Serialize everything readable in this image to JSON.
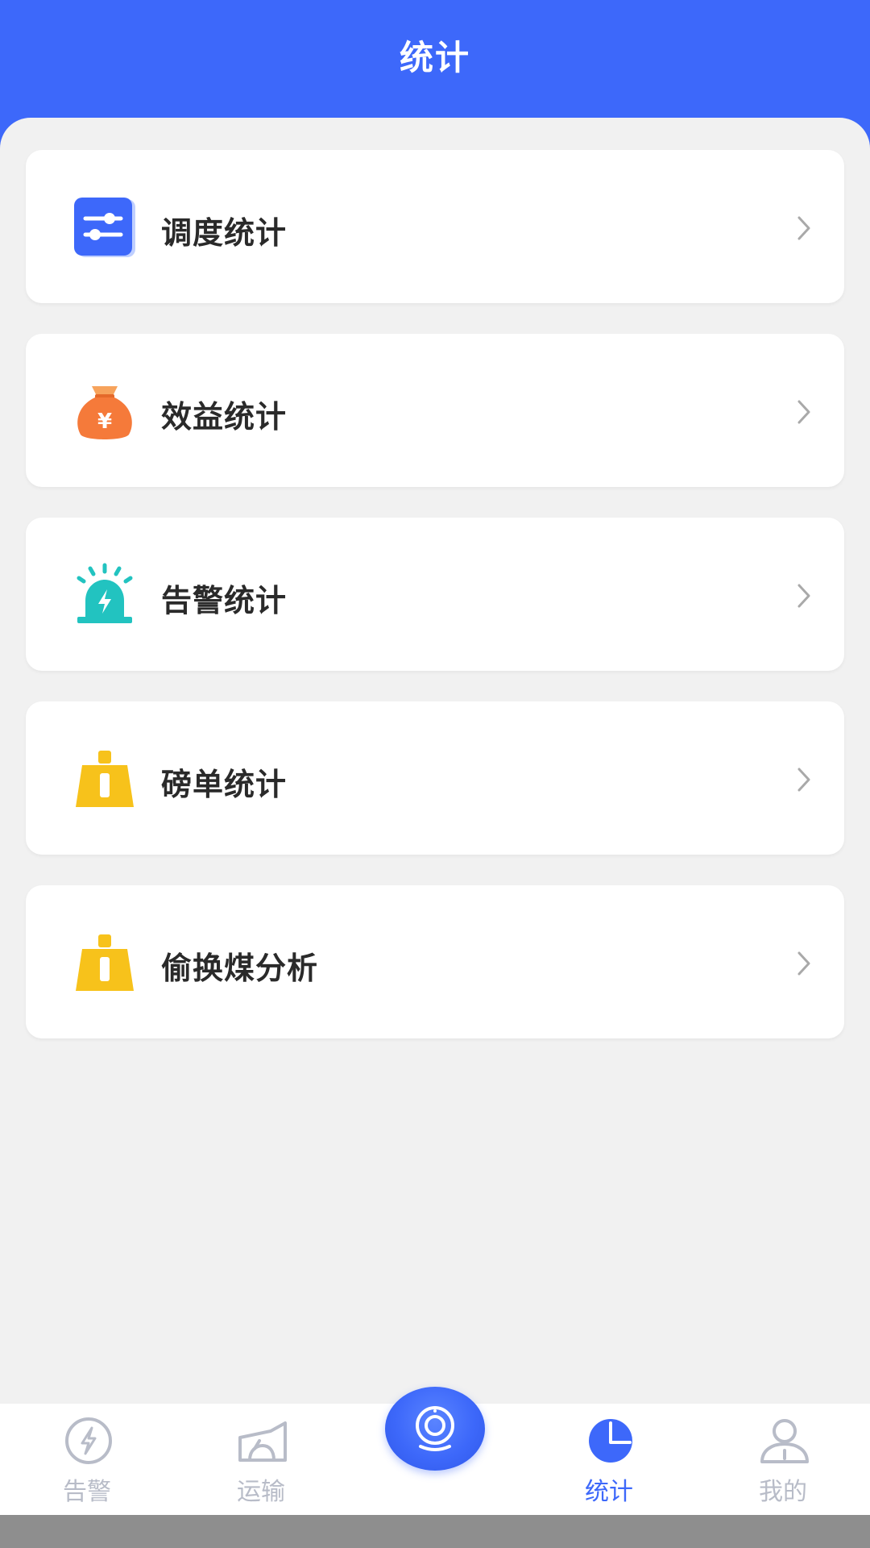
{
  "header": {
    "title": "统计"
  },
  "menu": {
    "items": [
      {
        "label": "调度统计",
        "icon": "sliders-icon"
      },
      {
        "label": "效益统计",
        "icon": "money-bag-icon"
      },
      {
        "label": "告警统计",
        "icon": "alarm-light-icon"
      },
      {
        "label": "磅单统计",
        "icon": "weight-icon"
      },
      {
        "label": "偷换煤分析",
        "icon": "weight-icon"
      }
    ]
  },
  "tabbar": {
    "items": [
      {
        "label": "告警",
        "icon": "lightning-circle-icon",
        "active": false
      },
      {
        "label": "运输",
        "icon": "transport-icon",
        "active": false
      },
      {
        "label": "",
        "icon": "camera-icon",
        "active": false
      },
      {
        "label": "统计",
        "icon": "pie-chart-icon",
        "active": true
      },
      {
        "label": "我的",
        "icon": "user-icon",
        "active": false
      }
    ]
  },
  "colors": {
    "primary": "#3d68fa",
    "background": "#f1f1f1",
    "card": "#ffffff",
    "tab_inactive": "#b8bcc8",
    "icon_orange": "#f57a3a",
    "icon_teal": "#22c3c0",
    "icon_yellow": "#f7c21b"
  }
}
